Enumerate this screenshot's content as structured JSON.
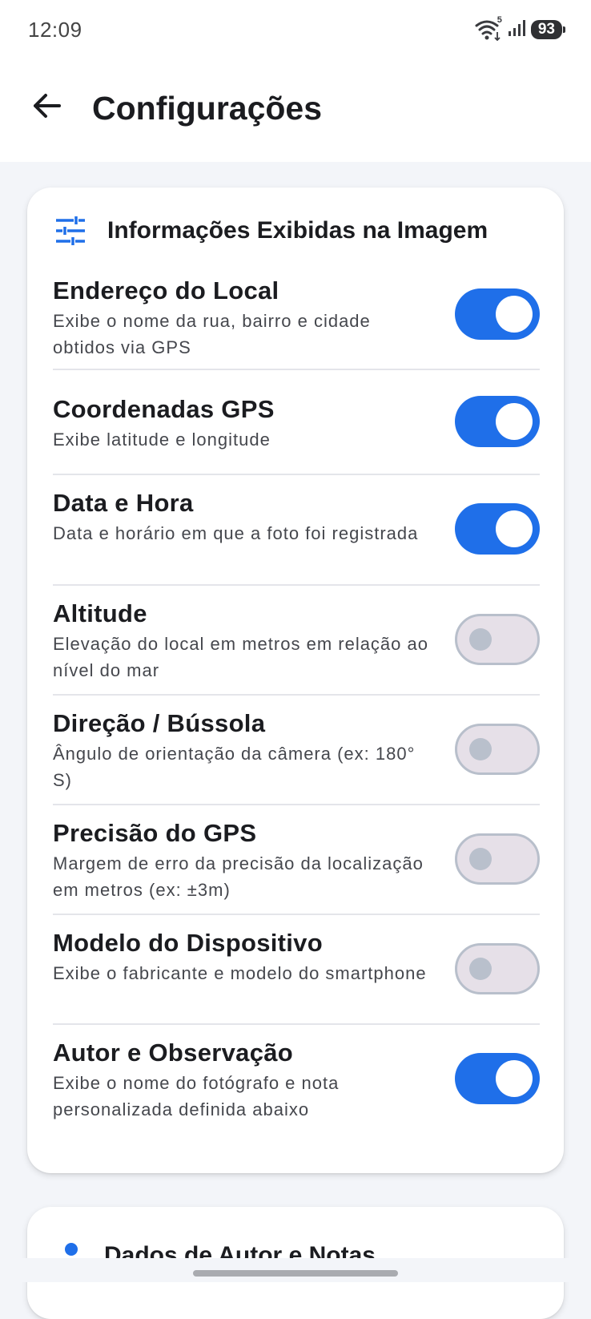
{
  "status_bar": {
    "time": "12:09",
    "wifi_badge": "5",
    "battery": "93",
    "icons": [
      "wifi-icon",
      "signal-icon",
      "battery-icon"
    ]
  },
  "app_bar": {
    "back_icon": "arrow-back-icon",
    "title": "Configurações"
  },
  "display_card": {
    "icon": "tune-sliders-icon",
    "title": "Informações Exibidas na Imagem",
    "items": [
      {
        "title": "Endereço do Local",
        "description": "Exibe o nome da rua, bairro e cidade obtidos via GPS",
        "enabled": true
      },
      {
        "title": "Coordenadas GPS",
        "description": "Exibe latitude e longitude",
        "enabled": true
      },
      {
        "title": "Data e Hora",
        "description": "Data e horário em que a foto foi registrada",
        "enabled": true
      },
      {
        "title": "Altitude",
        "description": "Elevação do local em metros em relação ao nível do mar",
        "enabled": false
      },
      {
        "title": "Direção / Bússola",
        "description": "Ângulo de orientação da câmera (ex: 180° S)",
        "enabled": false
      },
      {
        "title": "Precisão do GPS",
        "description": "Margem de erro da precisão da localização em metros (ex: ±3m)",
        "enabled": false
      },
      {
        "title": "Modelo do Dispositivo",
        "description": "Exibe o fabricante e modelo do smartphone",
        "enabled": false
      },
      {
        "title": "Autor e Observação",
        "description": "Exibe o nome do fotógrafo e nota personalizada definida abaixo",
        "enabled": true
      }
    ]
  },
  "author_card": {
    "icon": "person-icon",
    "title": "Dados de Autor e Notas"
  },
  "colors": {
    "accent": "#1f6fe9",
    "switch_off_track": "#e6e0e8",
    "switch_off_border": "#b8bfcb",
    "background": "#f3f5f9"
  }
}
